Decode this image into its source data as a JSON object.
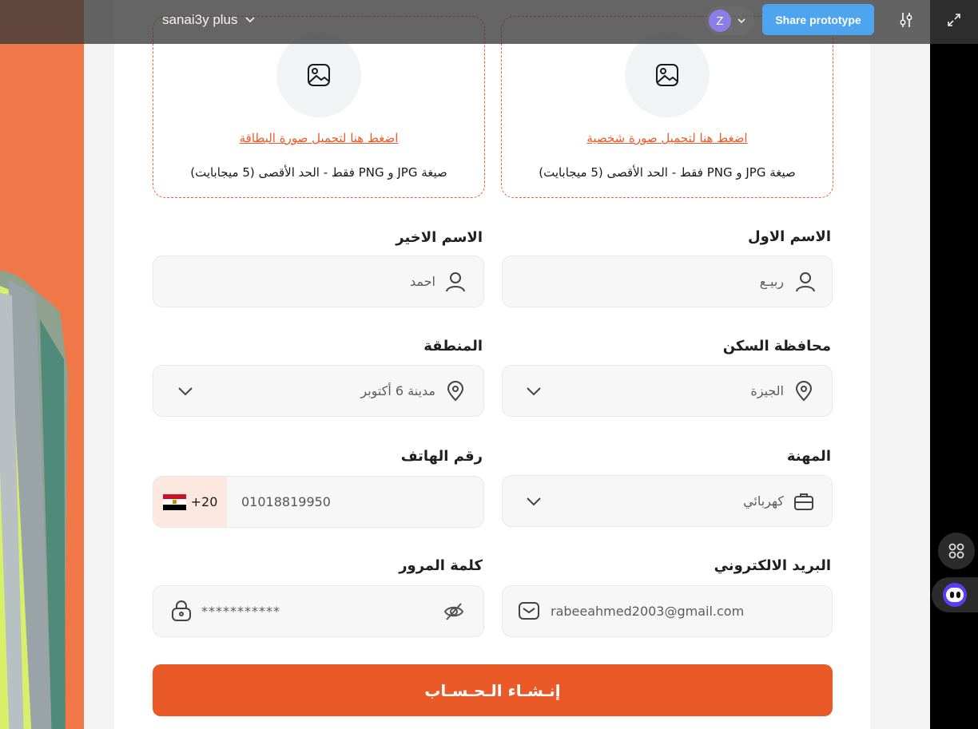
{
  "topbar": {
    "project_name": "sanai3y plus",
    "avatar_initial": "Z",
    "share_label": "Share prototype"
  },
  "upload_card": {
    "link": "اضغط هنا لتحميل صورة البطاقة",
    "hint": "صيغة JPG و PNG فقط - الحد الأقصى (5 ميجابايت)"
  },
  "upload_profile": {
    "link": "اضغط هنا لتحميل صورة شخصية",
    "hint": "صيغة JPG و PNG فقط - الحد الأقصى (5 ميجابايت)"
  },
  "form": {
    "first_name": {
      "label": "الاسم الاول",
      "value": "ربيـع"
    },
    "last_name": {
      "label": "الاسم الاخير",
      "value": "احمد"
    },
    "governorate": {
      "label": "محافظة السكن",
      "value": "الجيزة"
    },
    "area": {
      "label": "المنطقة",
      "value": "مدينة 6 أكتوبر"
    },
    "profession": {
      "label": "المهنة",
      "value": "كهربائي"
    },
    "phone": {
      "label": "رقم الهاتف",
      "prefix": "+20",
      "value": "01018819950"
    },
    "email": {
      "label": "البريد الالكتروني",
      "value": "rabeeahmed2003@gmail.com"
    },
    "password": {
      "label": "كلمة المرور",
      "value": "***********"
    }
  },
  "submit_label": "إنـشـاء الـحـسـاب",
  "colors": {
    "accent": "#ea5a28",
    "share_blue": "#4fa4f0",
    "panel_orange": "#f07748"
  },
  "icons": [
    "image-icon",
    "user-icon",
    "location-pin-icon",
    "chevron-down-icon",
    "briefcase-icon",
    "mail-icon",
    "lock-icon",
    "eye-off-icon",
    "egypt-flag-icon",
    "sliders-icon",
    "expand-icon",
    "grid-icon"
  ]
}
